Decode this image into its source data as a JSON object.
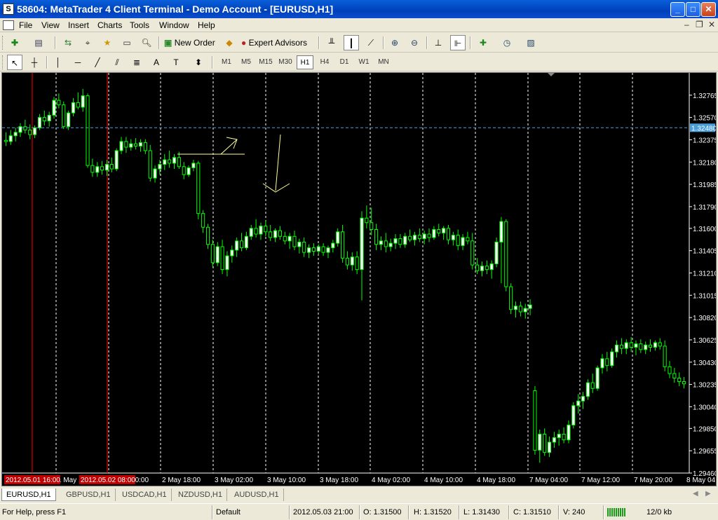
{
  "window": {
    "title": "58604: MetaTrader 4 Client Terminal - Demo Account - [EURUSD,H1]",
    "app_icon": "S",
    "min": "_",
    "max": "□",
    "close": "✕"
  },
  "menu": [
    "File",
    "View",
    "Insert",
    "Charts",
    "Tools",
    "Window",
    "Help"
  ],
  "mdi_controls": [
    "–",
    "❐",
    "✕"
  ],
  "toolbar": {
    "new_order": "New Order",
    "expert_advisors": "Expert Advisors"
  },
  "timeframes": [
    "M1",
    "M5",
    "M15",
    "M30",
    "H1",
    "H4",
    "D1",
    "W1",
    "MN"
  ],
  "active_timeframe": "H1",
  "chart_data": {
    "type": "candlestick",
    "symbol": "EURUSD",
    "timeframe": "H1",
    "price_ticks": [
      "1.32765",
      "1.32570",
      "1.32375",
      "1.32180",
      "1.31985",
      "1.31790",
      "1.31600",
      "1.31405",
      "1.31210",
      "1.31015",
      "1.30820",
      "1.30625",
      "1.30430",
      "1.30235",
      "1.30040",
      "1.29850",
      "1.29655",
      "1.29460"
    ],
    "current_price": "1.32480",
    "time_ticks": [
      "1 May 2012",
      "1 May 18:00",
      "2 May 10:00",
      "2 May 18:00",
      "3 May 02:00",
      "3 May 10:00",
      "3 May 18:00",
      "4 May 02:00",
      "4 May 10:00",
      "4 May 18:00",
      "7 May 04:00",
      "7 May 12:00",
      "7 May 20:00",
      "8 May 04:00"
    ],
    "highlighted_times": [
      "2012.05.01 16:00",
      "2012.05.02 08:00"
    ],
    "ylim": [
      1.2946,
      1.3296
    ],
    "candles": [
      [
        1.3237,
        1.3244,
        1.3232,
        1.3236
      ],
      [
        1.3236,
        1.3246,
        1.3233,
        1.3241
      ],
      [
        1.3241,
        1.3248,
        1.3236,
        1.3244
      ],
      [
        1.3244,
        1.3252,
        1.324,
        1.3249
      ],
      [
        1.3249,
        1.3255,
        1.3243,
        1.3246
      ],
      [
        1.3246,
        1.3251,
        1.3238,
        1.3242
      ],
      [
        1.3242,
        1.325,
        1.3239,
        1.3248
      ],
      [
        1.3248,
        1.326,
        1.3246,
        1.3257
      ],
      [
        1.3257,
        1.3263,
        1.325,
        1.3254
      ],
      [
        1.3254,
        1.3262,
        1.3249,
        1.3259
      ],
      [
        1.3259,
        1.3275,
        1.3256,
        1.3272
      ],
      [
        1.3272,
        1.3278,
        1.3265,
        1.3268
      ],
      [
        1.3268,
        1.3271,
        1.3247,
        1.3249
      ],
      [
        1.3249,
        1.3263,
        1.3246,
        1.3261
      ],
      [
        1.3261,
        1.3274,
        1.3258,
        1.327
      ],
      [
        1.327,
        1.3279,
        1.3264,
        1.3266
      ],
      [
        1.3266,
        1.3282,
        1.3262,
        1.3276
      ],
      [
        1.3276,
        1.3278,
        1.3213,
        1.3215
      ],
      [
        1.3215,
        1.3221,
        1.3205,
        1.3209
      ],
      [
        1.3209,
        1.3218,
        1.3205,
        1.3214
      ],
      [
        1.3214,
        1.3219,
        1.3207,
        1.3211
      ],
      [
        1.3211,
        1.322,
        1.3206,
        1.3216
      ],
      [
        1.3216,
        1.3222,
        1.3209,
        1.3212
      ],
      [
        1.3212,
        1.323,
        1.321,
        1.3228
      ],
      [
        1.3228,
        1.324,
        1.3225,
        1.3236
      ],
      [
        1.3236,
        1.324,
        1.3226,
        1.3231
      ],
      [
        1.3231,
        1.3238,
        1.3228,
        1.3234
      ],
      [
        1.3234,
        1.3239,
        1.3229,
        1.3232
      ],
      [
        1.3232,
        1.3238,
        1.3227,
        1.3235
      ],
      [
        1.3235,
        1.3238,
        1.3225,
        1.3228
      ],
      [
        1.3228,
        1.3233,
        1.3201,
        1.3204
      ],
      [
        1.3204,
        1.3215,
        1.32,
        1.3212
      ],
      [
        1.3212,
        1.322,
        1.3207,
        1.3216
      ],
      [
        1.3216,
        1.3225,
        1.3211,
        1.322
      ],
      [
        1.322,
        1.3228,
        1.3213,
        1.3217
      ],
      [
        1.3217,
        1.3225,
        1.3212,
        1.3222
      ],
      [
        1.3222,
        1.3227,
        1.3212,
        1.3214
      ],
      [
        1.3214,
        1.3218,
        1.3203,
        1.3207
      ],
      [
        1.3207,
        1.3215,
        1.3205,
        1.3213
      ],
      [
        1.3213,
        1.322,
        1.321,
        1.3217
      ],
      [
        1.3217,
        1.3219,
        1.3168,
        1.3173
      ],
      [
        1.3173,
        1.3176,
        1.3156,
        1.3161
      ],
      [
        1.3161,
        1.3164,
        1.3142,
        1.3146
      ],
      [
        1.3146,
        1.315,
        1.3126,
        1.313
      ],
      [
        1.313,
        1.3148,
        1.3127,
        1.3144
      ],
      [
        1.3144,
        1.315,
        1.312,
        1.3124
      ],
      [
        1.3124,
        1.314,
        1.3118,
        1.3136
      ],
      [
        1.3136,
        1.3145,
        1.313,
        1.3141
      ],
      [
        1.3141,
        1.3152,
        1.3135,
        1.3149
      ],
      [
        1.3149,
        1.3156,
        1.314,
        1.3143
      ],
      [
        1.3143,
        1.3157,
        1.3141,
        1.3153
      ],
      [
        1.3153,
        1.3163,
        1.315,
        1.316
      ],
      [
        1.316,
        1.3168,
        1.3152,
        1.3155
      ],
      [
        1.3155,
        1.3165,
        1.315,
        1.3162
      ],
      [
        1.3162,
        1.3167,
        1.3153,
        1.3157
      ],
      [
        1.3157,
        1.3163,
        1.3149,
        1.3152
      ],
      [
        1.3152,
        1.316,
        1.3148,
        1.3158
      ],
      [
        1.3158,
        1.3162,
        1.315,
        1.3153
      ],
      [
        1.3153,
        1.3157,
        1.3146,
        1.3149
      ],
      [
        1.3149,
        1.3156,
        1.3142,
        1.3153
      ],
      [
        1.3153,
        1.3158,
        1.3141,
        1.3144
      ],
      [
        1.3144,
        1.3151,
        1.3138,
        1.3148
      ],
      [
        1.3148,
        1.3152,
        1.3135,
        1.3139
      ],
      [
        1.3139,
        1.3146,
        1.3134,
        1.3143
      ],
      [
        1.3143,
        1.3147,
        1.3136,
        1.314
      ],
      [
        1.314,
        1.3146,
        1.3137,
        1.3144
      ],
      [
        1.3144,
        1.3147,
        1.3136,
        1.3139
      ],
      [
        1.3139,
        1.3145,
        1.3134,
        1.3143
      ],
      [
        1.3143,
        1.315,
        1.3139,
        1.3147
      ],
      [
        1.3147,
        1.316,
        1.3144,
        1.3157
      ],
      [
        1.3157,
        1.3163,
        1.313,
        1.3134
      ],
      [
        1.3134,
        1.314,
        1.3124,
        1.3128
      ],
      [
        1.3128,
        1.3139,
        1.3123,
        1.3135
      ],
      [
        1.3135,
        1.314,
        1.312,
        1.3124
      ],
      [
        1.3124,
        1.3175,
        1.3097,
        1.3169
      ],
      [
        1.3169,
        1.318,
        1.316,
        1.3165
      ],
      [
        1.3165,
        1.3178,
        1.3154,
        1.3159
      ],
      [
        1.3159,
        1.3164,
        1.3141,
        1.3146
      ],
      [
        1.3146,
        1.3153,
        1.3141,
        1.3149
      ],
      [
        1.3149,
        1.3156,
        1.3139,
        1.3144
      ],
      [
        1.3144,
        1.3151,
        1.314,
        1.3147
      ],
      [
        1.3147,
        1.3155,
        1.3142,
        1.3151
      ],
      [
        1.3151,
        1.3155,
        1.3143,
        1.3146
      ],
      [
        1.3146,
        1.3156,
        1.3143,
        1.3153
      ],
      [
        1.3153,
        1.3159,
        1.3148,
        1.315
      ],
      [
        1.315,
        1.3157,
        1.3145,
        1.3154
      ],
      [
        1.3154,
        1.316,
        1.3148,
        1.3151
      ],
      [
        1.3151,
        1.3158,
        1.3146,
        1.3155
      ],
      [
        1.3155,
        1.316,
        1.3148,
        1.3152
      ],
      [
        1.3152,
        1.3162,
        1.315,
        1.3159
      ],
      [
        1.3159,
        1.3164,
        1.3153,
        1.3156
      ],
      [
        1.3156,
        1.3162,
        1.315,
        1.316
      ],
      [
        1.316,
        1.3163,
        1.3146,
        1.315
      ],
      [
        1.315,
        1.3157,
        1.3145,
        1.3154
      ],
      [
        1.3154,
        1.3159,
        1.3141,
        1.3145
      ],
      [
        1.3145,
        1.3155,
        1.3141,
        1.3152
      ],
      [
        1.3152,
        1.3157,
        1.3146,
        1.3149
      ],
      [
        1.3149,
        1.3156,
        1.3124,
        1.3128
      ],
      [
        1.3128,
        1.3134,
        1.312,
        1.3123
      ],
      [
        1.3123,
        1.3131,
        1.3118,
        1.3127
      ],
      [
        1.3127,
        1.3132,
        1.312,
        1.3124
      ],
      [
        1.3124,
        1.3132,
        1.3116,
        1.3129
      ],
      [
        1.3129,
        1.3152,
        1.3126,
        1.3148
      ],
      [
        1.3148,
        1.317,
        1.3112,
        1.3166
      ],
      [
        1.3166,
        1.3168,
        1.3105,
        1.3109
      ],
      [
        1.3109,
        1.3112,
        1.3085,
        1.3089
      ],
      [
        1.3089,
        1.3096,
        1.3082,
        1.3092
      ],
      [
        1.3092,
        1.3096,
        1.3083,
        1.3087
      ],
      [
        1.3087,
        1.3094,
        1.3081,
        1.309
      ],
      [
        1.309,
        1.3098,
        1.3084,
        1.3093
      ],
      [
        1.3018,
        1.3022,
        1.2962,
        1.2966
      ],
      [
        1.2966,
        1.2984,
        1.2955,
        1.298
      ],
      [
        1.298,
        1.2985,
        1.2961,
        1.2964
      ],
      [
        1.2964,
        1.2978,
        1.296,
        1.2973
      ],
      [
        1.2973,
        1.2982,
        1.2968,
        1.2977
      ],
      [
        1.2977,
        1.2984,
        1.297,
        1.298
      ],
      [
        1.298,
        1.2986,
        1.2972,
        1.2975
      ],
      [
        1.2975,
        1.2992,
        1.2972,
        1.2988
      ],
      [
        1.2988,
        1.3008,
        1.2985,
        1.3005
      ],
      [
        1.3005,
        1.3015,
        1.2998,
        1.3009
      ],
      [
        1.3009,
        1.3017,
        1.3002,
        1.3013
      ],
      [
        1.3013,
        1.3028,
        1.301,
        1.3025
      ],
      [
        1.3025,
        1.3033,
        1.3016,
        1.302
      ],
      [
        1.302,
        1.304,
        1.3018,
        1.3038
      ],
      [
        1.3038,
        1.305,
        1.3033,
        1.3046
      ],
      [
        1.3046,
        1.3052,
        1.3035,
        1.304
      ],
      [
        1.304,
        1.3055,
        1.3038,
        1.3052
      ],
      [
        1.3052,
        1.3062,
        1.3047,
        1.3058
      ],
      [
        1.3058,
        1.3064,
        1.305,
        1.3055
      ],
      [
        1.3055,
        1.3063,
        1.305,
        1.306
      ],
      [
        1.306,
        1.3065,
        1.3052,
        1.3056
      ],
      [
        1.3056,
        1.3062,
        1.3049,
        1.3059
      ],
      [
        1.3059,
        1.3063,
        1.3051,
        1.3054
      ],
      [
        1.3054,
        1.3061,
        1.305,
        1.3058
      ],
      [
        1.3058,
        1.3063,
        1.3052,
        1.3056
      ],
      [
        1.3056,
        1.3062,
        1.3053,
        1.306
      ],
      [
        1.306,
        1.3064,
        1.3054,
        1.3057
      ],
      [
        1.3057,
        1.3062,
        1.3035,
        1.3039
      ],
      [
        1.3039,
        1.3044,
        1.3029,
        1.3033
      ],
      [
        1.3033,
        1.3038,
        1.3025,
        1.3029
      ],
      [
        1.3029,
        1.3034,
        1.3022,
        1.3026
      ],
      [
        1.3026,
        1.303,
        1.302,
        1.3024
      ]
    ]
  },
  "tabs": [
    "EURUSD,H1",
    "GBPUSD,H1",
    "USDCAD,H1",
    "NZDUSD,H1",
    "AUDUSD,H1"
  ],
  "status": {
    "help": "For Help, press F1",
    "profile": "Default",
    "time": "2012.05.03 21:00",
    "open": "O: 1.31500",
    "high": "H: 1.31520",
    "low": "L: 1.31430",
    "close": "C: 1.31510",
    "volume": "V: 240",
    "traffic": "12/0 kb"
  },
  "colors": {
    "bull_body": "#ffffff",
    "bear_body": "#000000",
    "candle_line": "#00ff00",
    "grid": "#ffffff",
    "period_sep": "#ff0000",
    "bid_line": "#4a9fd8",
    "drawing": "#ffff99"
  }
}
